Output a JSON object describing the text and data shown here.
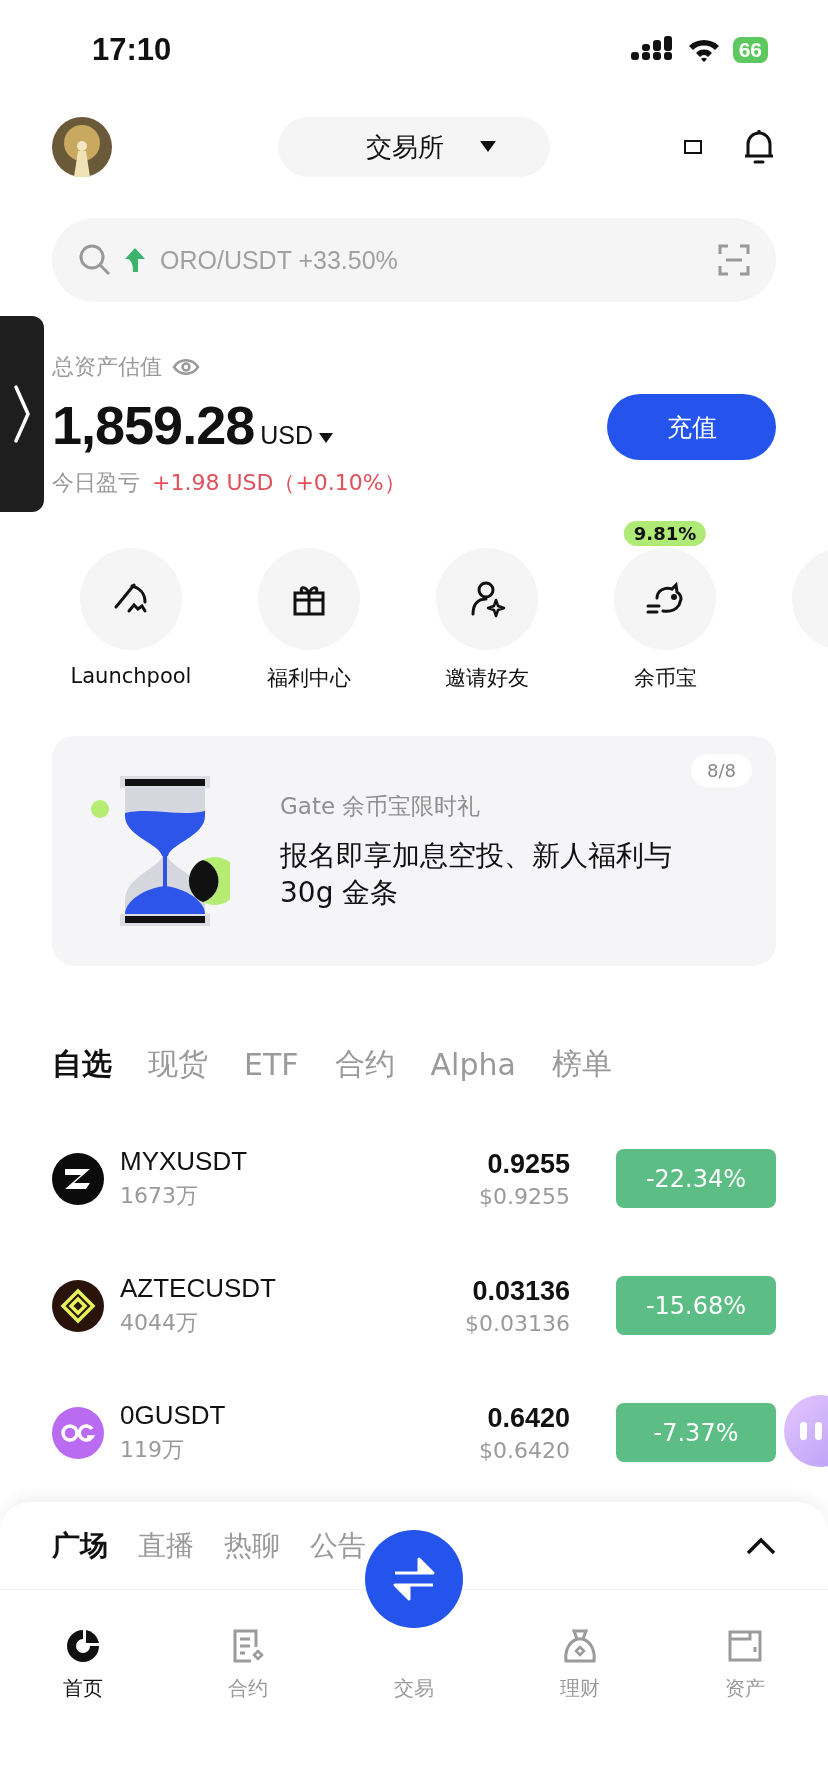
{
  "status_bar": {
    "time": "17:10",
    "battery": "66"
  },
  "header": {
    "exchange_label": "交易所"
  },
  "search": {
    "placeholder": "ORO/USDT +33.50%"
  },
  "assets": {
    "label": "总资产估值",
    "amount": "1,859.28",
    "currency": "USD",
    "pnl_label": "今日盈亏",
    "pnl_value": "+1.98 USD（+0.10%）",
    "deposit_button": "充值"
  },
  "shortcuts": [
    {
      "label": "Launchpool",
      "kind": "pickaxe"
    },
    {
      "label": "福利中心",
      "kind": "gift"
    },
    {
      "label": "邀请好友",
      "kind": "invite"
    },
    {
      "label": "余币宝",
      "kind": "piggy",
      "badge": "9.81%"
    }
  ],
  "banner": {
    "subtitle": "Gate 余币宝限时礼",
    "title": "报名即享加息空投、新人福利与30g 金条",
    "page": "8/8"
  },
  "market_tabs": [
    {
      "label": "自选",
      "selected": true
    },
    {
      "label": "现货",
      "selected": false
    },
    {
      "label": "ETF",
      "selected": false
    },
    {
      "label": "合约",
      "selected": false
    },
    {
      "label": "Alpha",
      "selected": false
    },
    {
      "label": "榜单",
      "selected": false
    }
  ],
  "pairs": [
    {
      "kind": "myx",
      "symbol": "MYXUSDT",
      "volume": "1673万",
      "price": "0.9255",
      "price_usd": "$0.9255",
      "change": "-22.34%"
    },
    {
      "kind": "aztec",
      "symbol": "AZTECUSDT",
      "volume": "4044万",
      "price": "0.03136",
      "price_usd": "$0.03136",
      "change": "-15.68%"
    },
    {
      "kind": "og",
      "symbol": "0GUSDT",
      "volume": "119万",
      "price": "0.6420",
      "price_usd": "$0.6420",
      "change": "-7.37%"
    }
  ],
  "feed_tabs": [
    {
      "label": "广场",
      "selected": true
    },
    {
      "label": "直播",
      "selected": false
    },
    {
      "label": "热聊",
      "selected": false
    },
    {
      "label": "公告",
      "selected": false
    }
  ],
  "nav": [
    {
      "kind": "home",
      "label": "首页",
      "selected": true
    },
    {
      "kind": "contract",
      "label": "合约",
      "selected": false
    },
    {
      "kind": "trade",
      "label": "交易",
      "selected": false
    },
    {
      "kind": "finance",
      "label": "理财",
      "selected": false
    },
    {
      "kind": "wallet",
      "label": "资产",
      "selected": false
    }
  ]
}
